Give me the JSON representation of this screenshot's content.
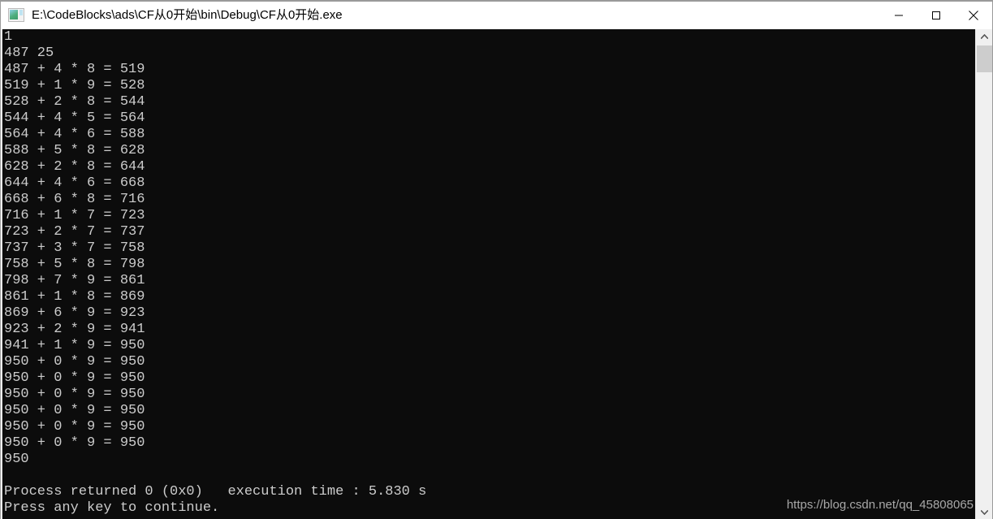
{
  "window": {
    "title": "E:\\CodeBlocks\\ads\\CF从0开始\\bin\\Debug\\CF从0开始.exe",
    "icon": "console-app-icon",
    "background_color": "#0c0c0c",
    "text_color": "#cccccc",
    "titlebar_color": "#ffffff"
  },
  "controls": {
    "minimize_label": "Minimize",
    "maximize_label": "Maximize",
    "close_label": "Close"
  },
  "scrollbar": {
    "up_arrow": "chevron-up-icon",
    "down_arrow": "chevron-down-icon",
    "thumb_position_percent": 3
  },
  "watermark": {
    "text": "https://blog.csdn.net/qq_45808065"
  },
  "console": {
    "lines": [
      "1",
      "487 25",
      "487 + 4 * 8 = 519",
      "519 + 1 * 9 = 528",
      "528 + 2 * 8 = 544",
      "544 + 4 * 5 = 564",
      "564 + 4 * 6 = 588",
      "588 + 5 * 8 = 628",
      "628 + 2 * 8 = 644",
      "644 + 4 * 6 = 668",
      "668 + 6 * 8 = 716",
      "716 + 1 * 7 = 723",
      "723 + 2 * 7 = 737",
      "737 + 3 * 7 = 758",
      "758 + 5 * 8 = 798",
      "798 + 7 * 9 = 861",
      "861 + 1 * 8 = 869",
      "869 + 6 * 9 = 923",
      "923 + 2 * 9 = 941",
      "941 + 1 * 9 = 950",
      "950 + 0 * 9 = 950",
      "950 + 0 * 9 = 950",
      "950 + 0 * 9 = 950",
      "950 + 0 * 9 = 950",
      "950 + 0 * 9 = 950",
      "950 + 0 * 9 = 950",
      "950",
      "",
      "Process returned 0 (0x0)   execution time : 5.830 s",
      "Press any key to continue."
    ],
    "text": "1\n487 25\n487 + 4 * 8 = 519\n519 + 1 * 9 = 528\n528 + 2 * 8 = 544\n544 + 4 * 5 = 564\n564 + 4 * 6 = 588\n588 + 5 * 8 = 628\n628 + 2 * 8 = 644\n644 + 4 * 6 = 668\n668 + 6 * 8 = 716\n716 + 1 * 7 = 723\n723 + 2 * 7 = 737\n737 + 3 * 7 = 758\n758 + 5 * 8 = 798\n798 + 7 * 9 = 861\n861 + 1 * 8 = 869\n869 + 6 * 9 = 923\n923 + 2 * 9 = 941\n941 + 1 * 9 = 950\n950 + 0 * 9 = 950\n950 + 0 * 9 = 950\n950 + 0 * 9 = 950\n950 + 0 * 9 = 950\n950 + 0 * 9 = 950\n950 + 0 * 9 = 950\n950\n\nProcess returned 0 (0x0)   execution time : 5.830 s\nPress any key to continue."
  }
}
